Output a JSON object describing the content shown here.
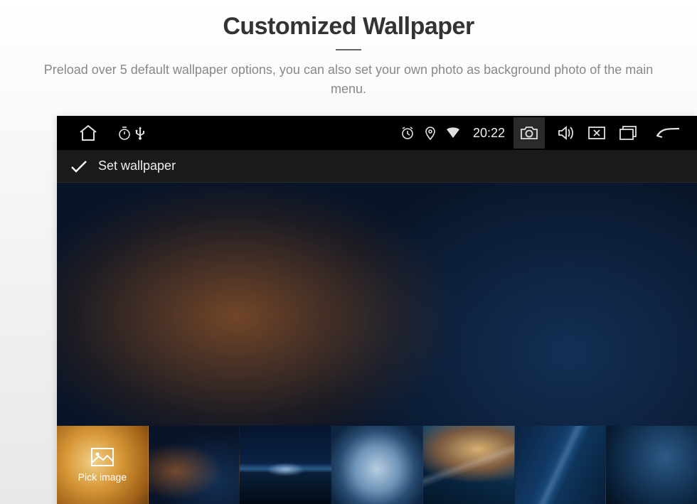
{
  "header": {
    "title": "Customized Wallpaper",
    "subtitle": "Preload over 5 default wallpaper options, you can also set your own photo as background photo of the main menu."
  },
  "statusbar": {
    "time": "20:22",
    "icons": {
      "home": "home-icon",
      "timer": "timer-icon",
      "usb": "usb-icon",
      "alarm": "alarm-icon",
      "location": "location-icon",
      "wifi": "wifi-icon",
      "camera": "camera-icon",
      "volume": "volume-icon",
      "close_screen": "close-screen-icon",
      "recents": "recents-icon",
      "back": "back-icon"
    }
  },
  "titlebar": {
    "confirm_icon": "check-icon",
    "label": "Set wallpaper"
  },
  "thumbs": {
    "pick_label": "Pick image",
    "pick_icon": "image-icon",
    "items": [
      {
        "name": "wallpaper-1"
      },
      {
        "name": "wallpaper-2"
      },
      {
        "name": "wallpaper-3"
      },
      {
        "name": "wallpaper-4"
      },
      {
        "name": "wallpaper-5"
      },
      {
        "name": "wallpaper-6"
      }
    ]
  },
  "colors": {
    "page_title": "#333333",
    "page_subtitle": "#888888",
    "device_bg": "#000000",
    "status_text": "#e0e0e0"
  }
}
